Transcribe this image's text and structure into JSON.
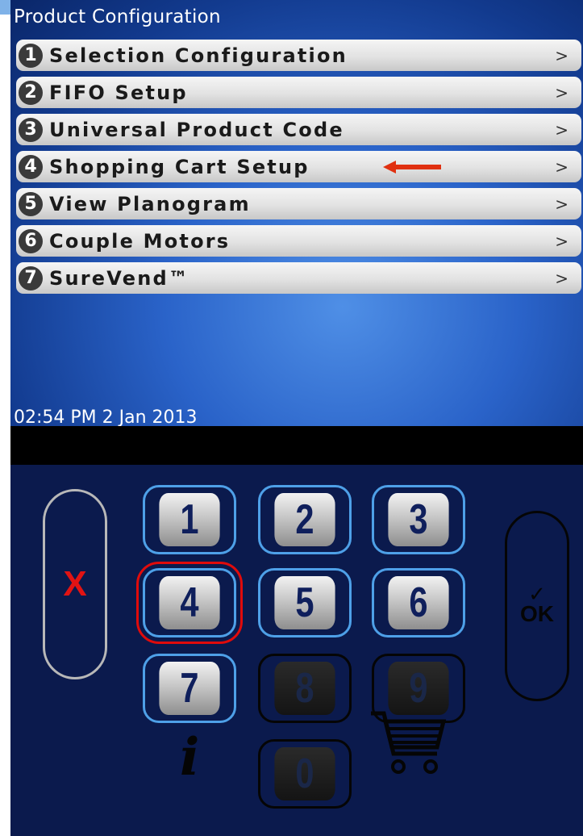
{
  "screen": {
    "title": "Product Configuration",
    "menu": [
      {
        "num": "1",
        "label": "Selection Configuration",
        "chevron": ">"
      },
      {
        "num": "2",
        "label": "FIFO Setup",
        "chevron": ">"
      },
      {
        "num": "3",
        "label": "Universal Product Code",
        "chevron": ">"
      },
      {
        "num": "4",
        "label": "Shopping Cart Setup",
        "chevron": ">"
      },
      {
        "num": "5",
        "label": "View Planogram",
        "chevron": ">"
      },
      {
        "num": "6",
        "label": "Couple Motors",
        "chevron": ">"
      },
      {
        "num": "7",
        "label": "SureVend™",
        "chevron": ">"
      }
    ],
    "highlighted_item": "4",
    "timestamp": "02:54 PM 2 Jan 2013"
  },
  "keypad": {
    "cancel_label": "X",
    "ok_label": "OK",
    "keys": {
      "k1": "1",
      "k2": "2",
      "k3": "3",
      "k4": "4",
      "k5": "5",
      "k6": "6",
      "k7": "7",
      "k8": "8",
      "k9": "9",
      "k0": "0"
    },
    "selected_key": "4",
    "info_icon": "info-icon",
    "cart_icon": "shopping-cart-icon"
  },
  "colors": {
    "screen_blue": "#2a63c9",
    "annotation_red": "#e03010",
    "key_border": "#4ea0e8",
    "cancel_red": "#e11313"
  }
}
